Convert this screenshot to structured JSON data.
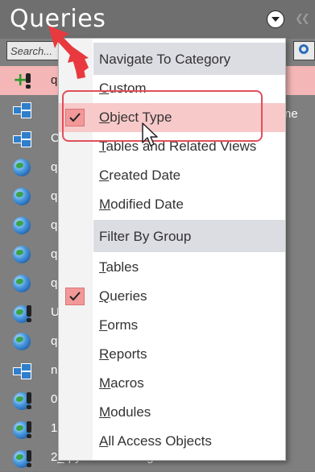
{
  "pane": {
    "title": "Queries",
    "search_placeholder": "Search...",
    "items": [
      {
        "label": "q",
        "icon": "append-query-icon",
        "selected": true
      },
      {
        "label": "",
        "icon": "form-icon"
      },
      {
        "label": "C",
        "icon": "form-icon"
      },
      {
        "label": "q",
        "icon": "globe-icon"
      },
      {
        "label": "q",
        "icon": "globe-icon"
      },
      {
        "label": "q",
        "icon": "globe-icon"
      },
      {
        "label": "q",
        "icon": "globe-icon"
      },
      {
        "label": "q",
        "icon": "globe-icon"
      },
      {
        "label": "U",
        "icon": "globe-query-icon"
      },
      {
        "label": "q",
        "icon": "globe-icon"
      },
      {
        "label": "n",
        "icon": "form-icon"
      },
      {
        "label": "0",
        "icon": "globe-query-icon"
      },
      {
        "label": "1",
        "icon": "globe-query-icon"
      },
      {
        "label": "2_qryAddNewImagestoPhotos",
        "icon": "globe-query-icon"
      }
    ],
    "right_edge_text": "ne"
  },
  "menu": {
    "header_navigate": "Navigate To Category",
    "navigate_items": [
      {
        "label": "Custom",
        "checked": false
      },
      {
        "label": "Object Type",
        "checked": true
      },
      {
        "label": "Tables and Related Views",
        "checked": false
      },
      {
        "label": "Created Date",
        "checked": false
      },
      {
        "label": "Modified Date",
        "checked": false
      }
    ],
    "header_filter": "Filter By Group",
    "filter_items": [
      {
        "label": "Tables",
        "checked": false
      },
      {
        "label": "Queries",
        "checked": true
      },
      {
        "label": "Forms",
        "checked": false
      },
      {
        "label": "Reports",
        "checked": false
      },
      {
        "label": "Macros",
        "checked": false
      },
      {
        "label": "Modules",
        "checked": false
      },
      {
        "label": "All Access Objects",
        "checked": false
      }
    ]
  },
  "colors": {
    "highlight": "#f8c9c9",
    "callout": "#e0505a",
    "arrow": "#e8393f"
  }
}
